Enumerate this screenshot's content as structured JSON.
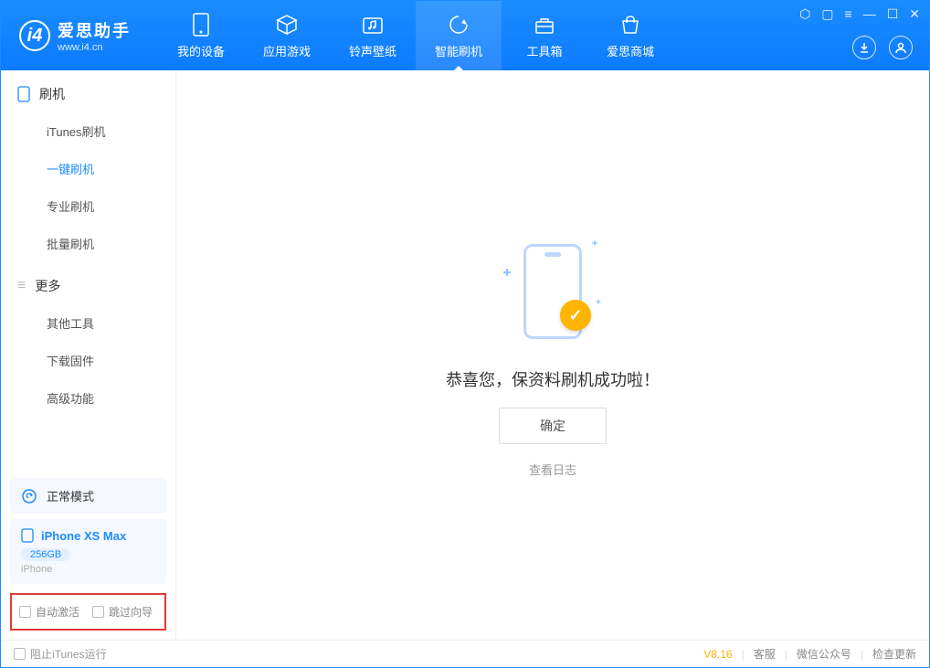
{
  "app": {
    "title": "爱思助手",
    "subtitle": "www.i4.cn"
  },
  "nav": {
    "items": [
      {
        "label": "我的设备"
      },
      {
        "label": "应用游戏"
      },
      {
        "label": "铃声壁纸"
      },
      {
        "label": "智能刷机"
      },
      {
        "label": "工具箱"
      },
      {
        "label": "爱思商城"
      }
    ],
    "active_index": 3
  },
  "sidebar": {
    "section1_title": "刷机",
    "items1": [
      {
        "label": "iTunes刷机"
      },
      {
        "label": "一键刷机"
      },
      {
        "label": "专业刷机"
      },
      {
        "label": "批量刷机"
      }
    ],
    "active1_index": 1,
    "section2_title": "更多",
    "items2": [
      {
        "label": "其他工具"
      },
      {
        "label": "下载固件"
      },
      {
        "label": "高级功能"
      }
    ],
    "mode_label": "正常模式",
    "device": {
      "name": "iPhone XS Max",
      "capacity": "256GB",
      "type": "iPhone"
    },
    "opts": {
      "auto_activate": "自动激活",
      "skip_guide": "跳过向导"
    }
  },
  "main": {
    "success_text": "恭喜您，保资料刷机成功啦！",
    "ok_label": "确定",
    "log_link": "查看日志"
  },
  "footer": {
    "block_itunes": "阻止iTunes运行",
    "version": "V8.16",
    "links": [
      "客服",
      "微信公众号",
      "检查更新"
    ]
  }
}
